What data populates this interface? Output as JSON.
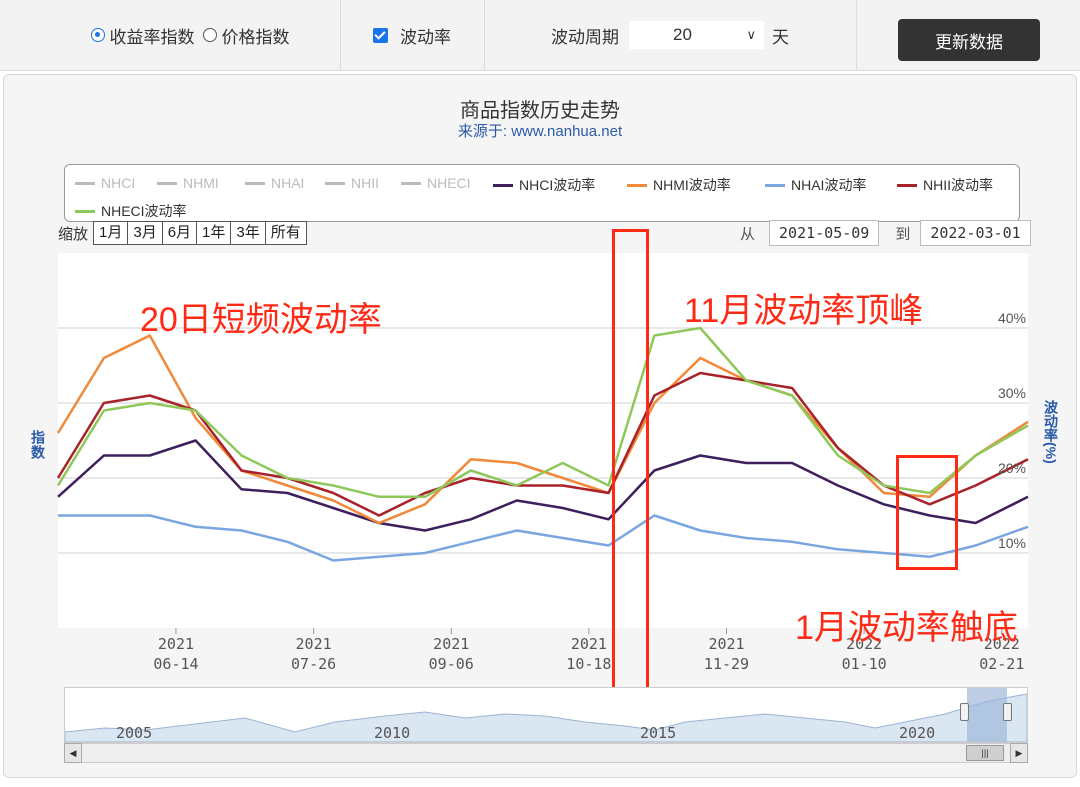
{
  "toolbar": {
    "radio_return": "收益率指数",
    "radio_price": "价格指数",
    "checkbox_vol": "波动率",
    "period_label": "波动周期",
    "period_value": "20",
    "period_unit": "天",
    "update_button": "更新数据"
  },
  "zoom": {
    "label": "缩放",
    "buttons": [
      "1月",
      "3月",
      "6月",
      "1年",
      "3年",
      "所有"
    ]
  },
  "range": {
    "from_label": "从",
    "from": "2021-05-09",
    "to_label": "到",
    "to": "2022-03-01"
  },
  "annotations": {
    "a1": "20日短频波动率",
    "a2": "11月波动率顶峰",
    "a3": "1月波动率触底"
  },
  "navigator": {
    "years": [
      "2005",
      "2010",
      "2015",
      "2020"
    ]
  },
  "colors": {
    "NHCI": "#3d1f5c",
    "NHMI": "#f08a3a",
    "NHAI": "#7aa6e0",
    "NHII": "#a8222a",
    "NHECI": "#8fc85a",
    "hidden": "#bbbbbb",
    "annotation": "#ff2a16"
  },
  "chart_data": {
    "type": "line",
    "title": "商品指数历史走势",
    "subtitle": "来源于: www.nanhua.net",
    "ylabel_left": "指数",
    "ylabel_right": "波动率(%)",
    "y_right_ticks": [
      "10%",
      "20%",
      "30%",
      "40%"
    ],
    "ylim_right": [
      0,
      50
    ],
    "x_range": [
      "2021-05-09",
      "2022-03-01"
    ],
    "x_ticks": [
      {
        "year": "2021",
        "date": "06-14"
      },
      {
        "year": "2021",
        "date": "07-26"
      },
      {
        "year": "2021",
        "date": "09-06"
      },
      {
        "year": "2021",
        "date": "10-18"
      },
      {
        "year": "2021",
        "date": "11-29"
      },
      {
        "year": "2022",
        "date": "01-10"
      },
      {
        "year": "2022",
        "date": "02-21"
      }
    ],
    "legend_hidden": [
      "NHCI",
      "NHMI",
      "NHAI",
      "NHII",
      "NHECI"
    ],
    "legend": [
      "NHCI波动率",
      "NHMI波动率",
      "NHAI波动率",
      "NHII波动率",
      "NHECI波动率"
    ],
    "x": [
      "2021-05-09",
      "2021-05-23",
      "2021-06-06",
      "2021-06-20",
      "2021-07-04",
      "2021-07-18",
      "2021-08-01",
      "2021-08-15",
      "2021-08-29",
      "2021-09-12",
      "2021-09-26",
      "2021-10-10",
      "2021-10-24",
      "2021-11-07",
      "2021-11-21",
      "2021-12-05",
      "2021-12-19",
      "2022-01-02",
      "2022-01-16",
      "2022-01-30",
      "2022-02-13",
      "2022-03-01"
    ],
    "series": [
      {
        "name": "NHCI波动率",
        "values": [
          17.5,
          23,
          23,
          25,
          18.5,
          18,
          16,
          14,
          13,
          14.5,
          17,
          16,
          14.5,
          21,
          23,
          22,
          22,
          19,
          16.5,
          15,
          14,
          17.5
        ]
      },
      {
        "name": "NHMI波动率",
        "values": [
          26,
          36,
          39,
          28,
          21,
          19,
          17,
          14,
          16.5,
          22.5,
          22,
          20,
          18,
          30,
          36,
          33,
          31,
          24,
          18,
          17.5,
          23,
          27.5
        ]
      },
      {
        "name": "NHAI波动率",
        "values": [
          15,
          15,
          15,
          13.5,
          13,
          11.5,
          9,
          9.5,
          10,
          11.5,
          13,
          12,
          11,
          15,
          13,
          12,
          11.5,
          10.5,
          10,
          9.5,
          11,
          13.5
        ]
      },
      {
        "name": "NHII波动率",
        "values": [
          20,
          30,
          31,
          29,
          21,
          20,
          18,
          15,
          18,
          20,
          19,
          19,
          18,
          31,
          34,
          33,
          32,
          24,
          19,
          16.5,
          19,
          22.5
        ]
      },
      {
        "name": "NHECI波动率",
        "values": [
          19,
          29,
          30,
          29,
          23,
          20,
          19,
          17.5,
          17.5,
          21,
          19,
          22,
          19,
          39,
          40,
          33,
          31,
          23,
          19,
          18,
          23,
          27
        ]
      }
    ]
  }
}
